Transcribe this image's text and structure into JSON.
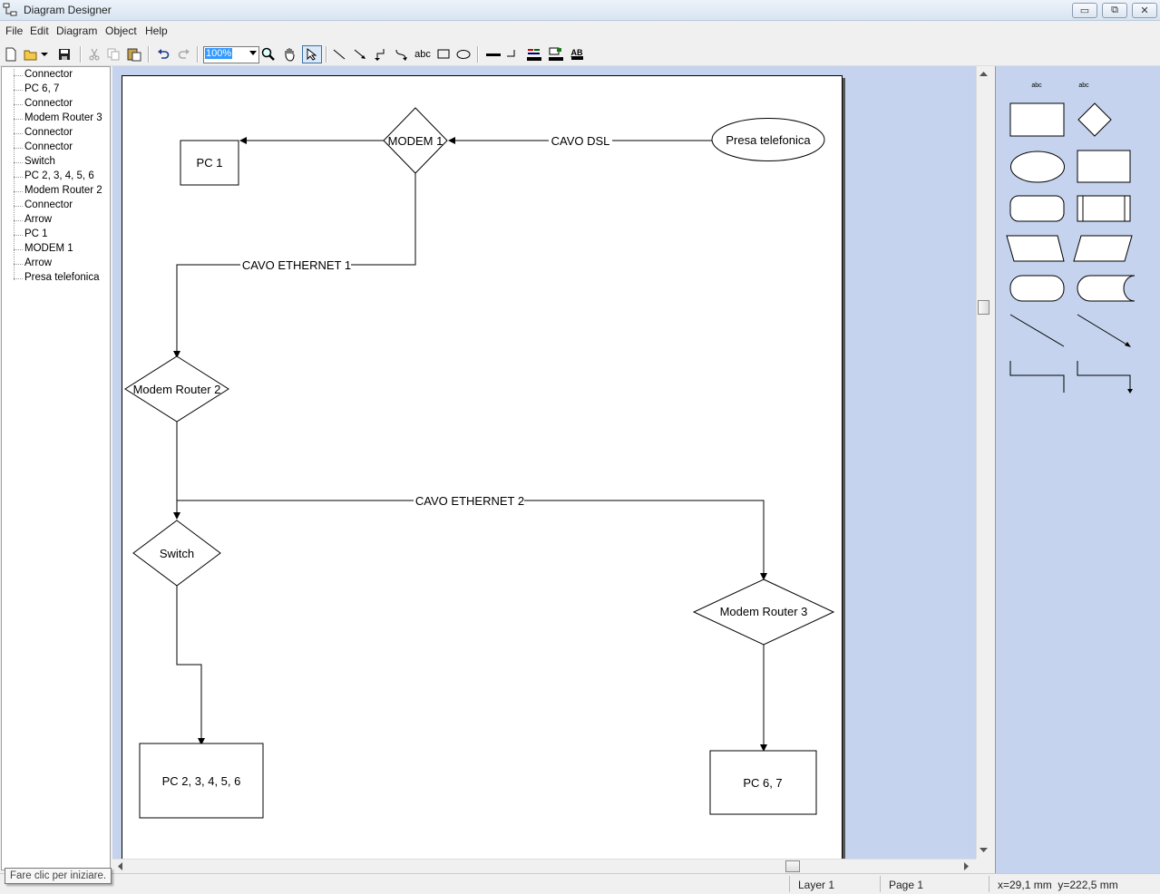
{
  "window": {
    "title": "Diagram Designer",
    "minimize": "▭",
    "maximize": "⧉",
    "close": "✕"
  },
  "menu": [
    "File",
    "Edit",
    "Diagram",
    "Object",
    "Help"
  ],
  "toolbar": {
    "zoom": "100%",
    "text_tool": "abc",
    "text_fmt": "AB"
  },
  "tree": [
    "Connector",
    "PC 6, 7",
    "Connector",
    "Modem Router 3",
    "Connector",
    "Connector",
    "Switch",
    "PC 2, 3, 4, 5, 6",
    "Modem Router 2",
    "Connector",
    "Arrow",
    "PC 1",
    "MODEM 1",
    "Arrow",
    "Presa telefonica"
  ],
  "diagram": {
    "nodes": {
      "pc1": "PC 1",
      "modem1": "MODEM 1",
      "presa": "Presa telefonica",
      "modem_router2": "Modem Router 2",
      "switch": "Switch",
      "modem_router3": "Modem Router 3",
      "pc23456": "PC 2, 3, 4, 5, 6",
      "pc67": "PC 6, 7"
    },
    "edges": {
      "cavo_dsl": "CAVO DSL",
      "cavo_eth1": "CAVO ETHERNET 1",
      "cavo_eth2": "CAVO ETHERNET 2"
    }
  },
  "palette": {
    "label_left": "abc",
    "label_right": "abc"
  },
  "status": {
    "tooltip": "Fare clic per iniziare.",
    "layer": "Layer 1",
    "page": "Page 1",
    "coords": "x=29,1 mm  y=222,5 mm"
  },
  "colors": {
    "canvas_bg": "#c5d3ee",
    "selection": "#3399ff"
  }
}
